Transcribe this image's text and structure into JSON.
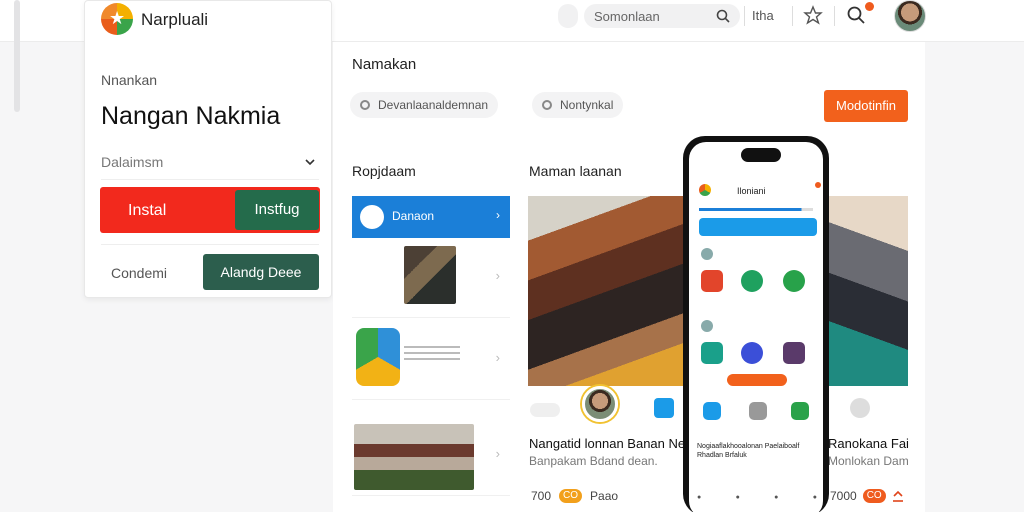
{
  "topbar": {
    "search_text": "Somonlaan",
    "link": "Itha"
  },
  "card": {
    "brand": "Narpluali",
    "label": "Nnankan",
    "title": "Nangan Nakmia",
    "dropdown": "Dalaimsm",
    "install_label": "Instal",
    "install_secondary": "Instfug",
    "secondary_label": "Condemi",
    "dark_button": "Alandg Deee"
  },
  "main": {
    "heading": "Namakan",
    "chips": [
      "Devanlaanaldemnan",
      "Nontynkal"
    ],
    "orange_button": "Modotinfin",
    "section_left": "Ropjdaam",
    "section_right": "Maman laanan",
    "active_item": "Danaon"
  },
  "card_bottom": {
    "title": "Nangatid lonnan Banan Ne",
    "subtitle": "Banpakam Bdand dean.",
    "meta_count": "700",
    "meta_badge": "CO",
    "meta_text": "Paao"
  },
  "right_card": {
    "title": "Ranokana Fai",
    "subtitle": "Monlokan Dam",
    "meta_count": "7000",
    "meta_badge": "CO"
  },
  "phone": {
    "title": "Iloniani",
    "text": "Nogiaaflakhooalonan Paelaiboalf Rhadlan Brfaluk"
  },
  "colors": {
    "accent_red": "#f2291d",
    "accent_green": "#246b4b",
    "accent_orange": "#f2611c",
    "accent_blue": "#1b7fd8"
  }
}
